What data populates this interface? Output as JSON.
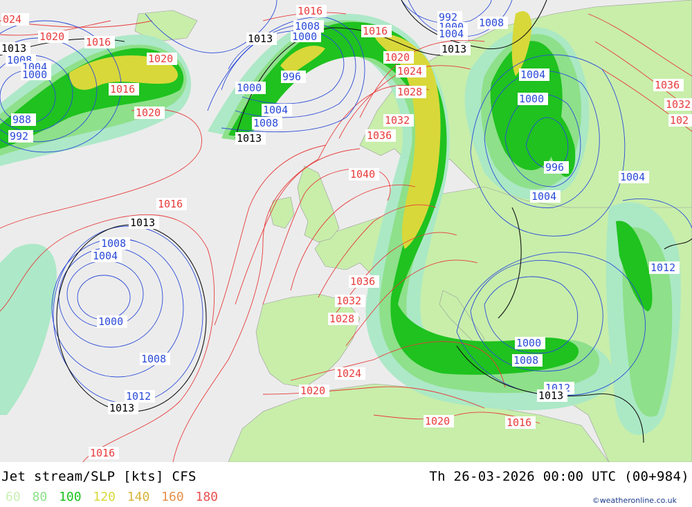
{
  "title": "Jet stream/SLP [kts] CFS",
  "datetime": "Th 26-03-2026 00:00 UTC (00+984)",
  "credit": "©weatheronline.co.uk",
  "legend": [
    {
      "label": "60",
      "color": "#c9f0b4"
    },
    {
      "label": "80",
      "color": "#8ee08a"
    },
    {
      "label": "100",
      "color": "#1fc21f"
    },
    {
      "label": "120",
      "color": "#d8d83a"
    },
    {
      "label": "140",
      "color": "#d8b43a"
    },
    {
      "label": "160",
      "color": "#e8904a"
    },
    {
      "label": "180",
      "color": "#e85050"
    }
  ],
  "isobars_red": [
    "024",
    "1020",
    "1016",
    "1020",
    "1016",
    "1020",
    "1016",
    "1016",
    "1020",
    "1024",
    "1028",
    "1032",
    "1036",
    "1040",
    "1036",
    "1032",
    "1028",
    "1024",
    "1020",
    "1020",
    "1016",
    "1016",
    "1036",
    "1032",
    "102"
  ],
  "isobars_blue": [
    "1008",
    "1004",
    "1000",
    "988",
    "992",
    "1008",
    "1000",
    "996",
    "1000",
    "1004",
    "1008",
    "992",
    "1000",
    "1004",
    "1008",
    "1004",
    "1000",
    "996",
    "1004",
    "1004",
    "1012",
    "1008",
    "1004",
    "1000",
    "1008",
    "1012",
    "1000",
    "1008",
    "1012"
  ],
  "isobars_black": [
    "1013",
    "1013",
    "1013",
    "1013",
    "1013",
    "1013",
    "1013"
  ]
}
